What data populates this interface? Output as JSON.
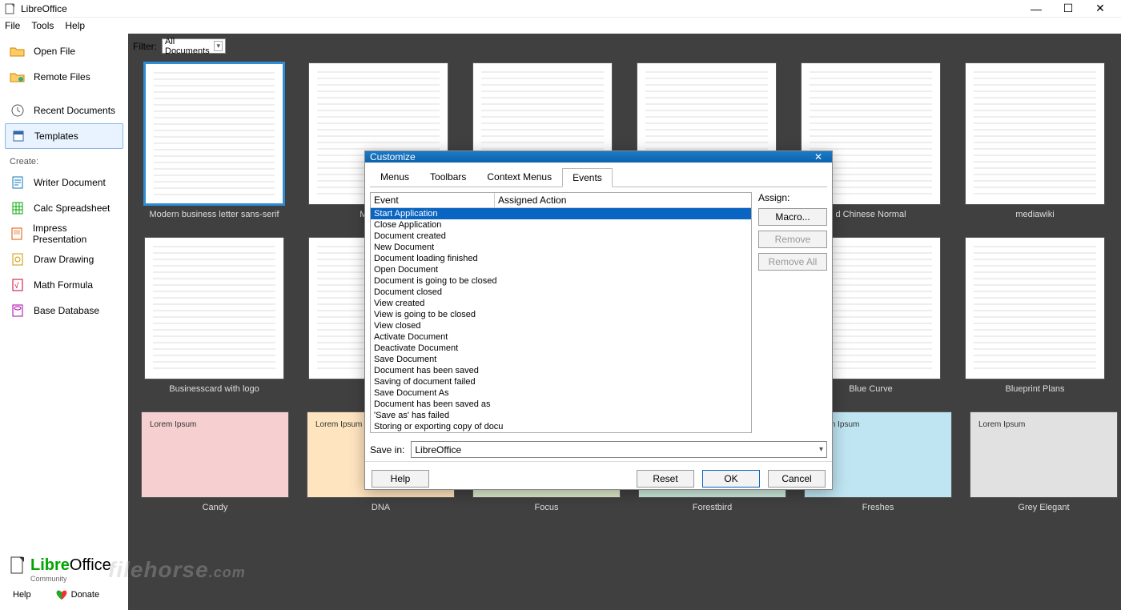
{
  "window": {
    "title": "LibreOffice",
    "min": "—",
    "max": "☐",
    "close": "✕"
  },
  "menubar": [
    "File",
    "Tools",
    "Help"
  ],
  "sidebar": {
    "actions": [
      {
        "icon": "folder-open-icon",
        "label": "Open File"
      },
      {
        "icon": "remote-icon",
        "label": "Remote Files"
      },
      {
        "icon": "clock-icon",
        "label": "Recent Documents"
      },
      {
        "icon": "templates-icon",
        "label": "Templates",
        "selected": true
      }
    ],
    "create_label": "Create:",
    "create": [
      {
        "icon": "writer-icon",
        "label": "Writer Document"
      },
      {
        "icon": "calc-icon",
        "label": "Calc Spreadsheet"
      },
      {
        "icon": "impress-icon",
        "label": "Impress Presentation"
      },
      {
        "icon": "draw-icon",
        "label": "Draw Drawing"
      },
      {
        "icon": "math-icon",
        "label": "Math Formula"
      },
      {
        "icon": "base-icon",
        "label": "Base Database"
      }
    ],
    "brand": {
      "name": "LibreOffice",
      "sub": "Community"
    },
    "help_label": "Help",
    "donate_label": "Donate"
  },
  "filter": {
    "label": "Filter:",
    "value": "All Documents"
  },
  "templates_row1": [
    "Modern business letter sans-serif",
    "Modern b",
    "",
    "",
    "d Chinese Normal",
    "mediawiki"
  ],
  "templates_row2": [
    "Businesscard with logo",
    "",
    "",
    "",
    "Blue Curve",
    "Blueprint Plans"
  ],
  "templates_row3": [
    "Candy",
    "DNA",
    "Focus",
    "Forestbird",
    "Freshes",
    "Grey Elegant"
  ],
  "dialog": {
    "title": "Customize",
    "close": "✕",
    "tabs": [
      "Menus",
      "Toolbars",
      "Context Menus",
      "Events"
    ],
    "active_tab": 3,
    "event_col": "Event",
    "action_col": "Assigned Action",
    "events": [
      "Start Application",
      "Close Application",
      "Document created",
      "New Document",
      "Document loading finished",
      "Open Document",
      "Document is going to be closed",
      "Document closed",
      "View created",
      "View is going to be closed",
      "View closed",
      "Activate Document",
      "Deactivate Document",
      "Save Document",
      "Document has been saved",
      "Saving of document failed",
      "Save Document As",
      "Document has been saved as",
      "'Save as' has failed",
      "Storing or exporting copy of docu"
    ],
    "selected_event": 0,
    "assign_label": "Assign:",
    "macro_btn": "Macro...",
    "remove_btn": "Remove",
    "remove_all_btn": "Remove All",
    "save_in_label": "Save in:",
    "save_in_value": "LibreOffice",
    "help_btn": "Help",
    "reset_btn": "Reset",
    "ok_btn": "OK",
    "cancel_btn": "Cancel"
  },
  "watermark": {
    "text": "filehorse",
    "suffix": ".com"
  }
}
